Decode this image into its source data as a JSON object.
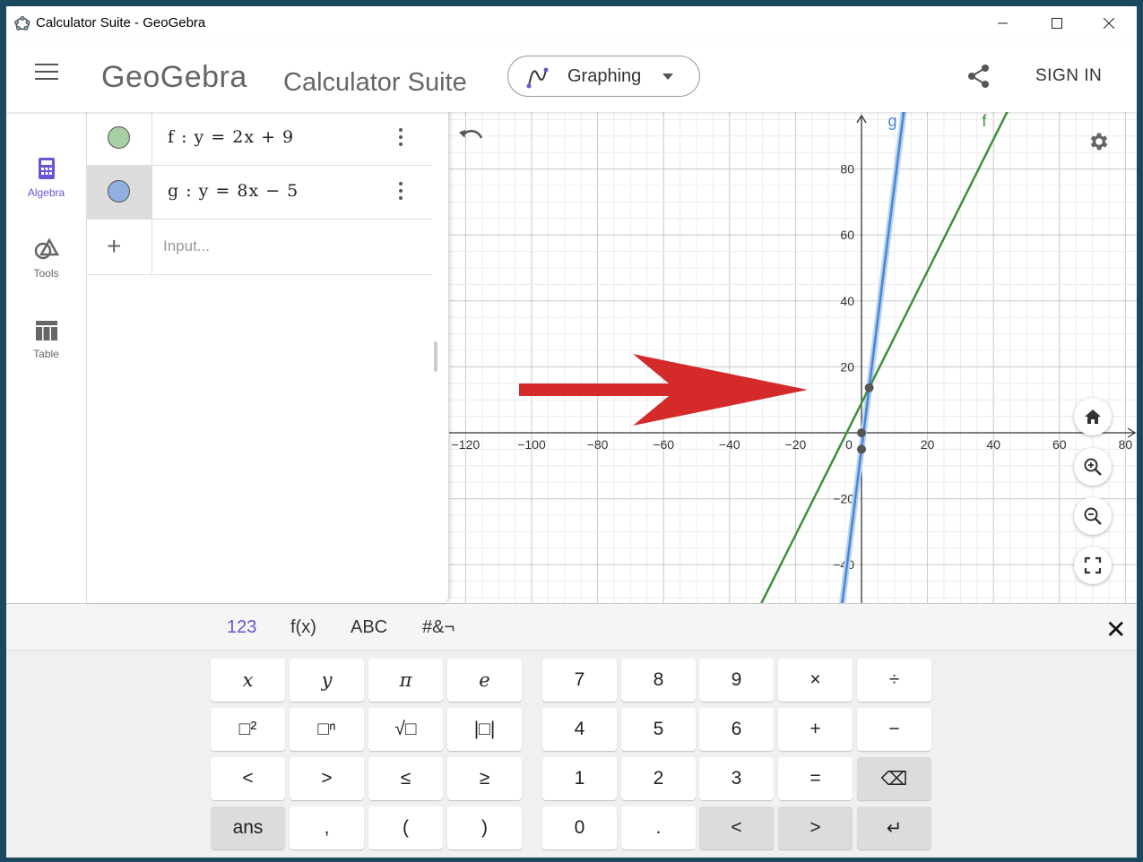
{
  "window": {
    "title": "Calculator Suite - GeoGebra"
  },
  "header": {
    "logo": "GeoGebra",
    "suite_title": "Calculator Suite",
    "app_selector": {
      "label": "Graphing",
      "icon": "graphing-icon"
    },
    "share_icon": "share-icon",
    "signin_label": "SIGN IN"
  },
  "sidenav": {
    "items": [
      {
        "label": "Algebra",
        "icon": "calculator-icon",
        "active": true
      },
      {
        "label": "Tools",
        "icon": "shapes-icon",
        "active": false
      },
      {
        "label": "Table",
        "icon": "table-icon",
        "active": false
      }
    ]
  },
  "algebra": {
    "rows": [
      {
        "expression": "f : y = 2x + 9",
        "color": "#a8cfa4"
      },
      {
        "expression": "g : y = 8x − 5",
        "color": "#8fb0e0"
      }
    ],
    "input_placeholder": "Input..."
  },
  "graph": {
    "x_ticks": [
      "−120",
      "−100",
      "−80",
      "−60",
      "−40",
      "−20",
      "0",
      "20",
      "40",
      "60",
      "80"
    ],
    "y_ticks": [
      "80",
      "60",
      "40",
      "20",
      "−20",
      "−40"
    ],
    "curves": [
      {
        "name": "f",
        "color": "#3f8f3f"
      },
      {
        "name": "g",
        "color": "#4a86d6"
      }
    ],
    "annotation": {
      "type": "red-arrow",
      "color": "#d42a2a"
    }
  },
  "keyboard": {
    "tabs": [
      "123",
      "f(x)",
      "ABC",
      "#&¬"
    ],
    "active_tab": "123",
    "left_keys": [
      [
        "x",
        "y",
        "π",
        "e"
      ],
      [
        "□²",
        "□ⁿ",
        "√□",
        "|□|"
      ],
      [
        "<",
        ">",
        "≤",
        "≥"
      ],
      [
        "ans",
        ",",
        "(",
        ")"
      ]
    ],
    "right_keys": [
      [
        "7",
        "8",
        "9",
        "×",
        "÷"
      ],
      [
        "4",
        "5",
        "6",
        "+",
        "−"
      ],
      [
        "1",
        "2",
        "3",
        "=",
        "⌫"
      ],
      [
        "0",
        ".",
        "<",
        ">",
        "↵"
      ]
    ]
  }
}
